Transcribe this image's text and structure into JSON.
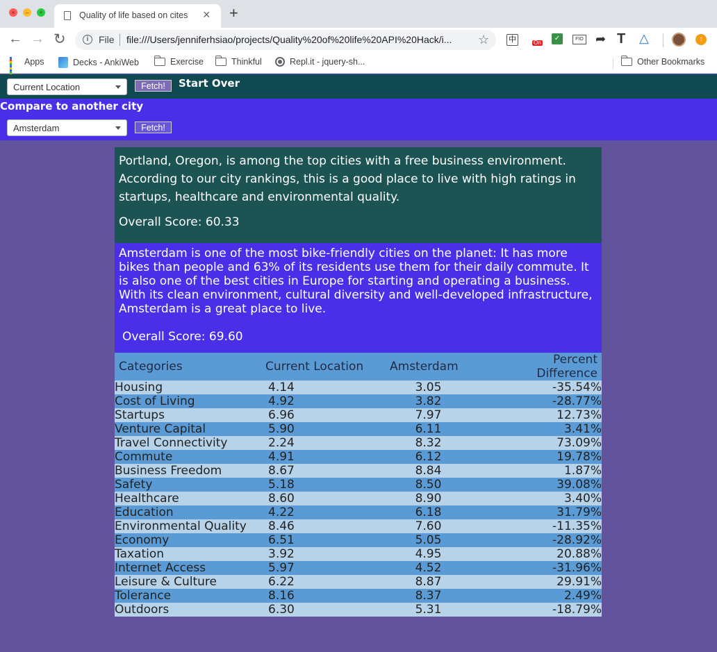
{
  "browser": {
    "tab_title": "Quality of life based on cites",
    "url_scheme": "File",
    "url": "file:///Users/jenniferhsiao/projects/Quality%20of%20life%20API%20Hack/i...",
    "bookmarks": [
      "Apps",
      "Decks - AnkiWeb",
      "Exercise",
      "Thinkful",
      "Repl.it - jquery-sh..."
    ],
    "other_bookmarks": "Other Bookmarks"
  },
  "controls": {
    "city_select_value": "Current Location",
    "fetch_label": "Fetch!",
    "start_over": "Start Over",
    "compare_label": "Compare to another city",
    "compare_select_value": "Amsterdam",
    "compare_fetch_label": "Fetch!"
  },
  "city1": {
    "summary": "Portland, Oregon, is among the top cities with a free business environment. According to our city rankings, this is a good place to live with high ratings in startups, healthcare and environmental quality.",
    "score": "Overall Score: 60.33"
  },
  "city2": {
    "summary": "Amsterdam is one of the most bike-friendly cities on the planet: It has more bikes than people and 63% of its residents use them for their daily commute. It is also one of the best cities in Europe for starting and operating a business. With its clean environment, cultural diversity and well-developed infrastructure, Amsterdam is a great place to live.",
    "score": "Overall Score: 69.60"
  },
  "table": {
    "headers": [
      "Categories",
      "Current Location",
      "Amsterdam",
      "Percent Difference"
    ],
    "rows": [
      [
        "Housing",
        "4.14",
        "3.05",
        "-35.54%"
      ],
      [
        "Cost of Living",
        "4.92",
        "3.82",
        "-28.77%"
      ],
      [
        "Startups",
        "6.96",
        "7.97",
        "12.73%"
      ],
      [
        "Venture Capital",
        "5.90",
        "6.11",
        "3.41%"
      ],
      [
        "Travel Connectivity",
        "2.24",
        "8.32",
        "73.09%"
      ],
      [
        "Commute",
        "4.91",
        "6.12",
        "19.78%"
      ],
      [
        "Business Freedom",
        "8.67",
        "8.84",
        "1.87%"
      ],
      [
        "Safety",
        "5.18",
        "8.50",
        "39.08%"
      ],
      [
        "Healthcare",
        "8.60",
        "8.90",
        "3.40%"
      ],
      [
        "Education",
        "4.22",
        "6.18",
        "31.79%"
      ],
      [
        "Environmental Quality",
        "8.46",
        "7.60",
        "-11.35%"
      ],
      [
        "Economy",
        "6.51",
        "5.05",
        "-28.92%"
      ],
      [
        "Taxation",
        "3.92",
        "4.95",
        "20.88%"
      ],
      [
        "Internet Access",
        "5.97",
        "4.52",
        "-31.96%"
      ],
      [
        "Leisure & Culture",
        "6.22",
        "8.87",
        "29.91%"
      ],
      [
        "Tolerance",
        "8.16",
        "8.37",
        "2.49%"
      ],
      [
        "Outdoors",
        "6.30",
        "5.31",
        "-18.79%"
      ]
    ]
  }
}
